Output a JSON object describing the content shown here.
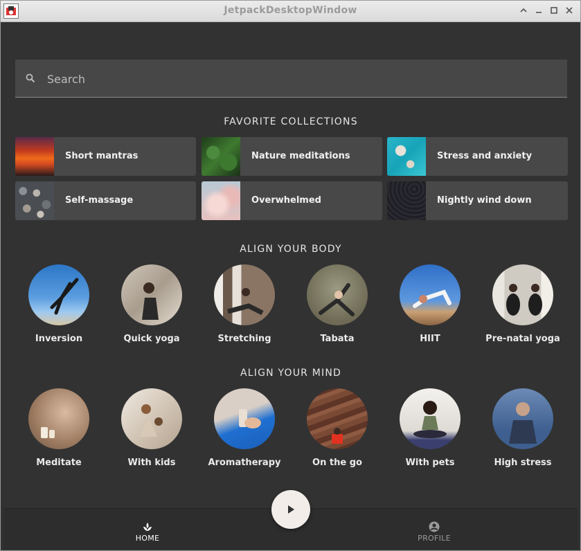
{
  "window": {
    "title": "JetpackDesktopWindow",
    "controls": [
      "chevron-up-icon",
      "minimize-icon",
      "maximize-icon",
      "close-icon"
    ]
  },
  "search": {
    "placeholder": "Search",
    "value": ""
  },
  "favorites": {
    "title": "FAVORITE COLLECTIONS",
    "items": [
      {
        "label": "Short mantras",
        "thumb": "sunset-sky"
      },
      {
        "label": "Nature meditations",
        "thumb": "green-leaves"
      },
      {
        "label": "Stress and anxiety",
        "thumb": "turquoise-sea"
      },
      {
        "label": "Self-massage",
        "thumb": "pebbles"
      },
      {
        "label": "Overwhelmed",
        "thumb": "pink-clouds"
      },
      {
        "label": "Nightly wind down",
        "thumb": "night-sky"
      }
    ]
  },
  "body": {
    "title": "ALIGN YOUR BODY",
    "items": [
      {
        "label": "Inversion"
      },
      {
        "label": "Quick yoga"
      },
      {
        "label": "Stretching"
      },
      {
        "label": "Tabata"
      },
      {
        "label": "HIIT"
      },
      {
        "label": "Pre-natal yoga"
      }
    ]
  },
  "mind": {
    "title": "ALIGN YOUR MIND",
    "items": [
      {
        "label": "Meditate"
      },
      {
        "label": "With kids"
      },
      {
        "label": "Aromatherapy"
      },
      {
        "label": "On the go"
      },
      {
        "label": "With pets"
      },
      {
        "label": "High stress"
      }
    ]
  },
  "nav": {
    "home": "HOME",
    "profile": "PROFILE",
    "active": "home"
  },
  "colors": {
    "background": "#323232",
    "card": "#484848",
    "fab": "#f2ede8",
    "nav_active": "#ffffff",
    "nav_inactive": "#9a9a9a"
  }
}
